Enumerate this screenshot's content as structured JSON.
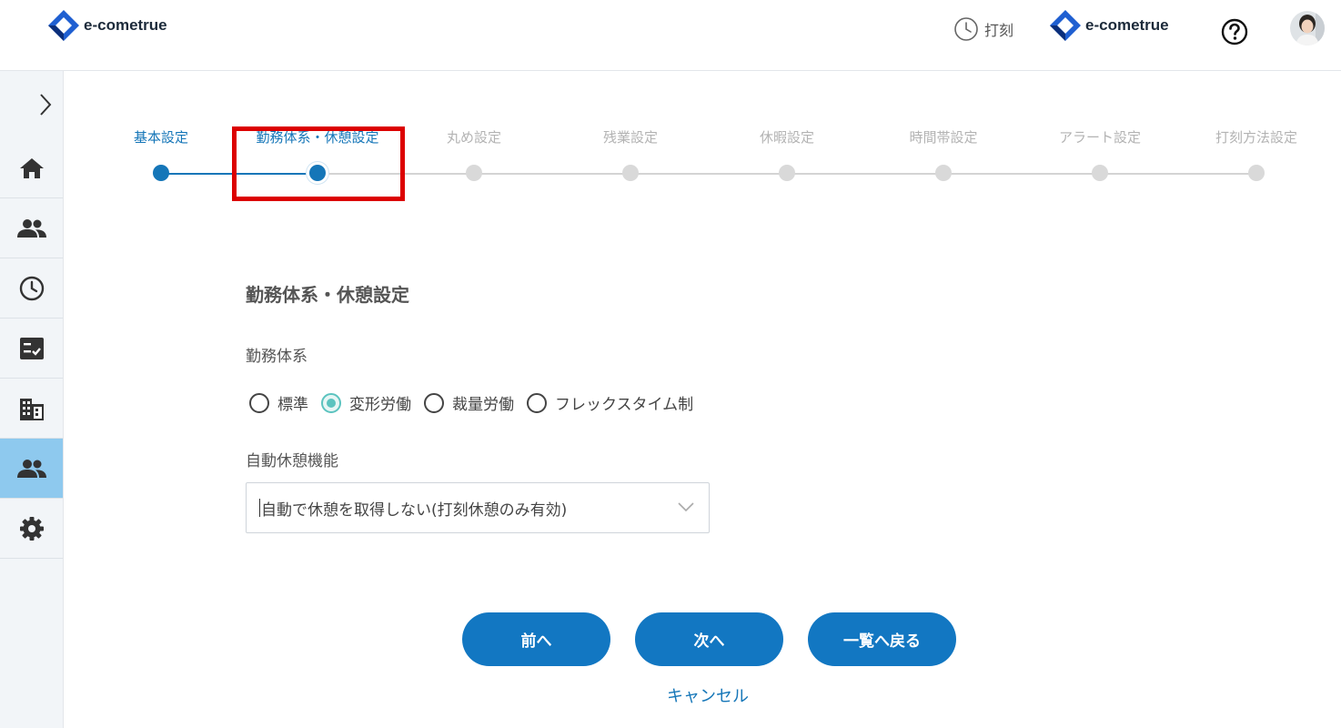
{
  "header": {
    "logo_text": "e-cometrue",
    "punch_label": "打刻",
    "right_logo_text": "e-cometrue"
  },
  "sidebar": {
    "items": [
      {
        "icon": "home-icon"
      },
      {
        "icon": "users-icon"
      },
      {
        "icon": "clock-icon"
      },
      {
        "icon": "checklist-icon"
      },
      {
        "icon": "building-icon"
      },
      {
        "icon": "team-icon",
        "active": true
      },
      {
        "icon": "gear-icon"
      }
    ]
  },
  "stepper": {
    "steps": [
      {
        "label": "基本設定",
        "state": "done"
      },
      {
        "label": "勤務体系・休憩設定",
        "state": "current"
      },
      {
        "label": "丸め設定",
        "state": "todo"
      },
      {
        "label": "残業設定",
        "state": "todo"
      },
      {
        "label": "休暇設定",
        "state": "todo"
      },
      {
        "label": "時間帯設定",
        "state": "todo"
      },
      {
        "label": "アラート設定",
        "state": "todo"
      },
      {
        "label": "打刻方法設定",
        "state": "todo"
      }
    ]
  },
  "form": {
    "title": "勤務体系・休憩設定",
    "work_system_label": "勤務体系",
    "work_system_options": [
      {
        "label": "標準",
        "checked": false
      },
      {
        "label": "変形労働",
        "checked": true
      },
      {
        "label": "裁量労働",
        "checked": false
      },
      {
        "label": "フレックスタイム制",
        "checked": false
      }
    ],
    "auto_break_label": "自動休憩機能",
    "auto_break_value": "自動で休憩を取得しない(打刻休憩のみ有効)"
  },
  "buttons": {
    "prev": "前へ",
    "next": "次へ",
    "back_to_list": "一覧へ戻る",
    "cancel": "キャンセル"
  },
  "colors": {
    "primary": "#1277c2",
    "active_sidebar": "#8ec9ee",
    "radio_checked": "#5bc3bf",
    "highlight": "#dc0000"
  }
}
